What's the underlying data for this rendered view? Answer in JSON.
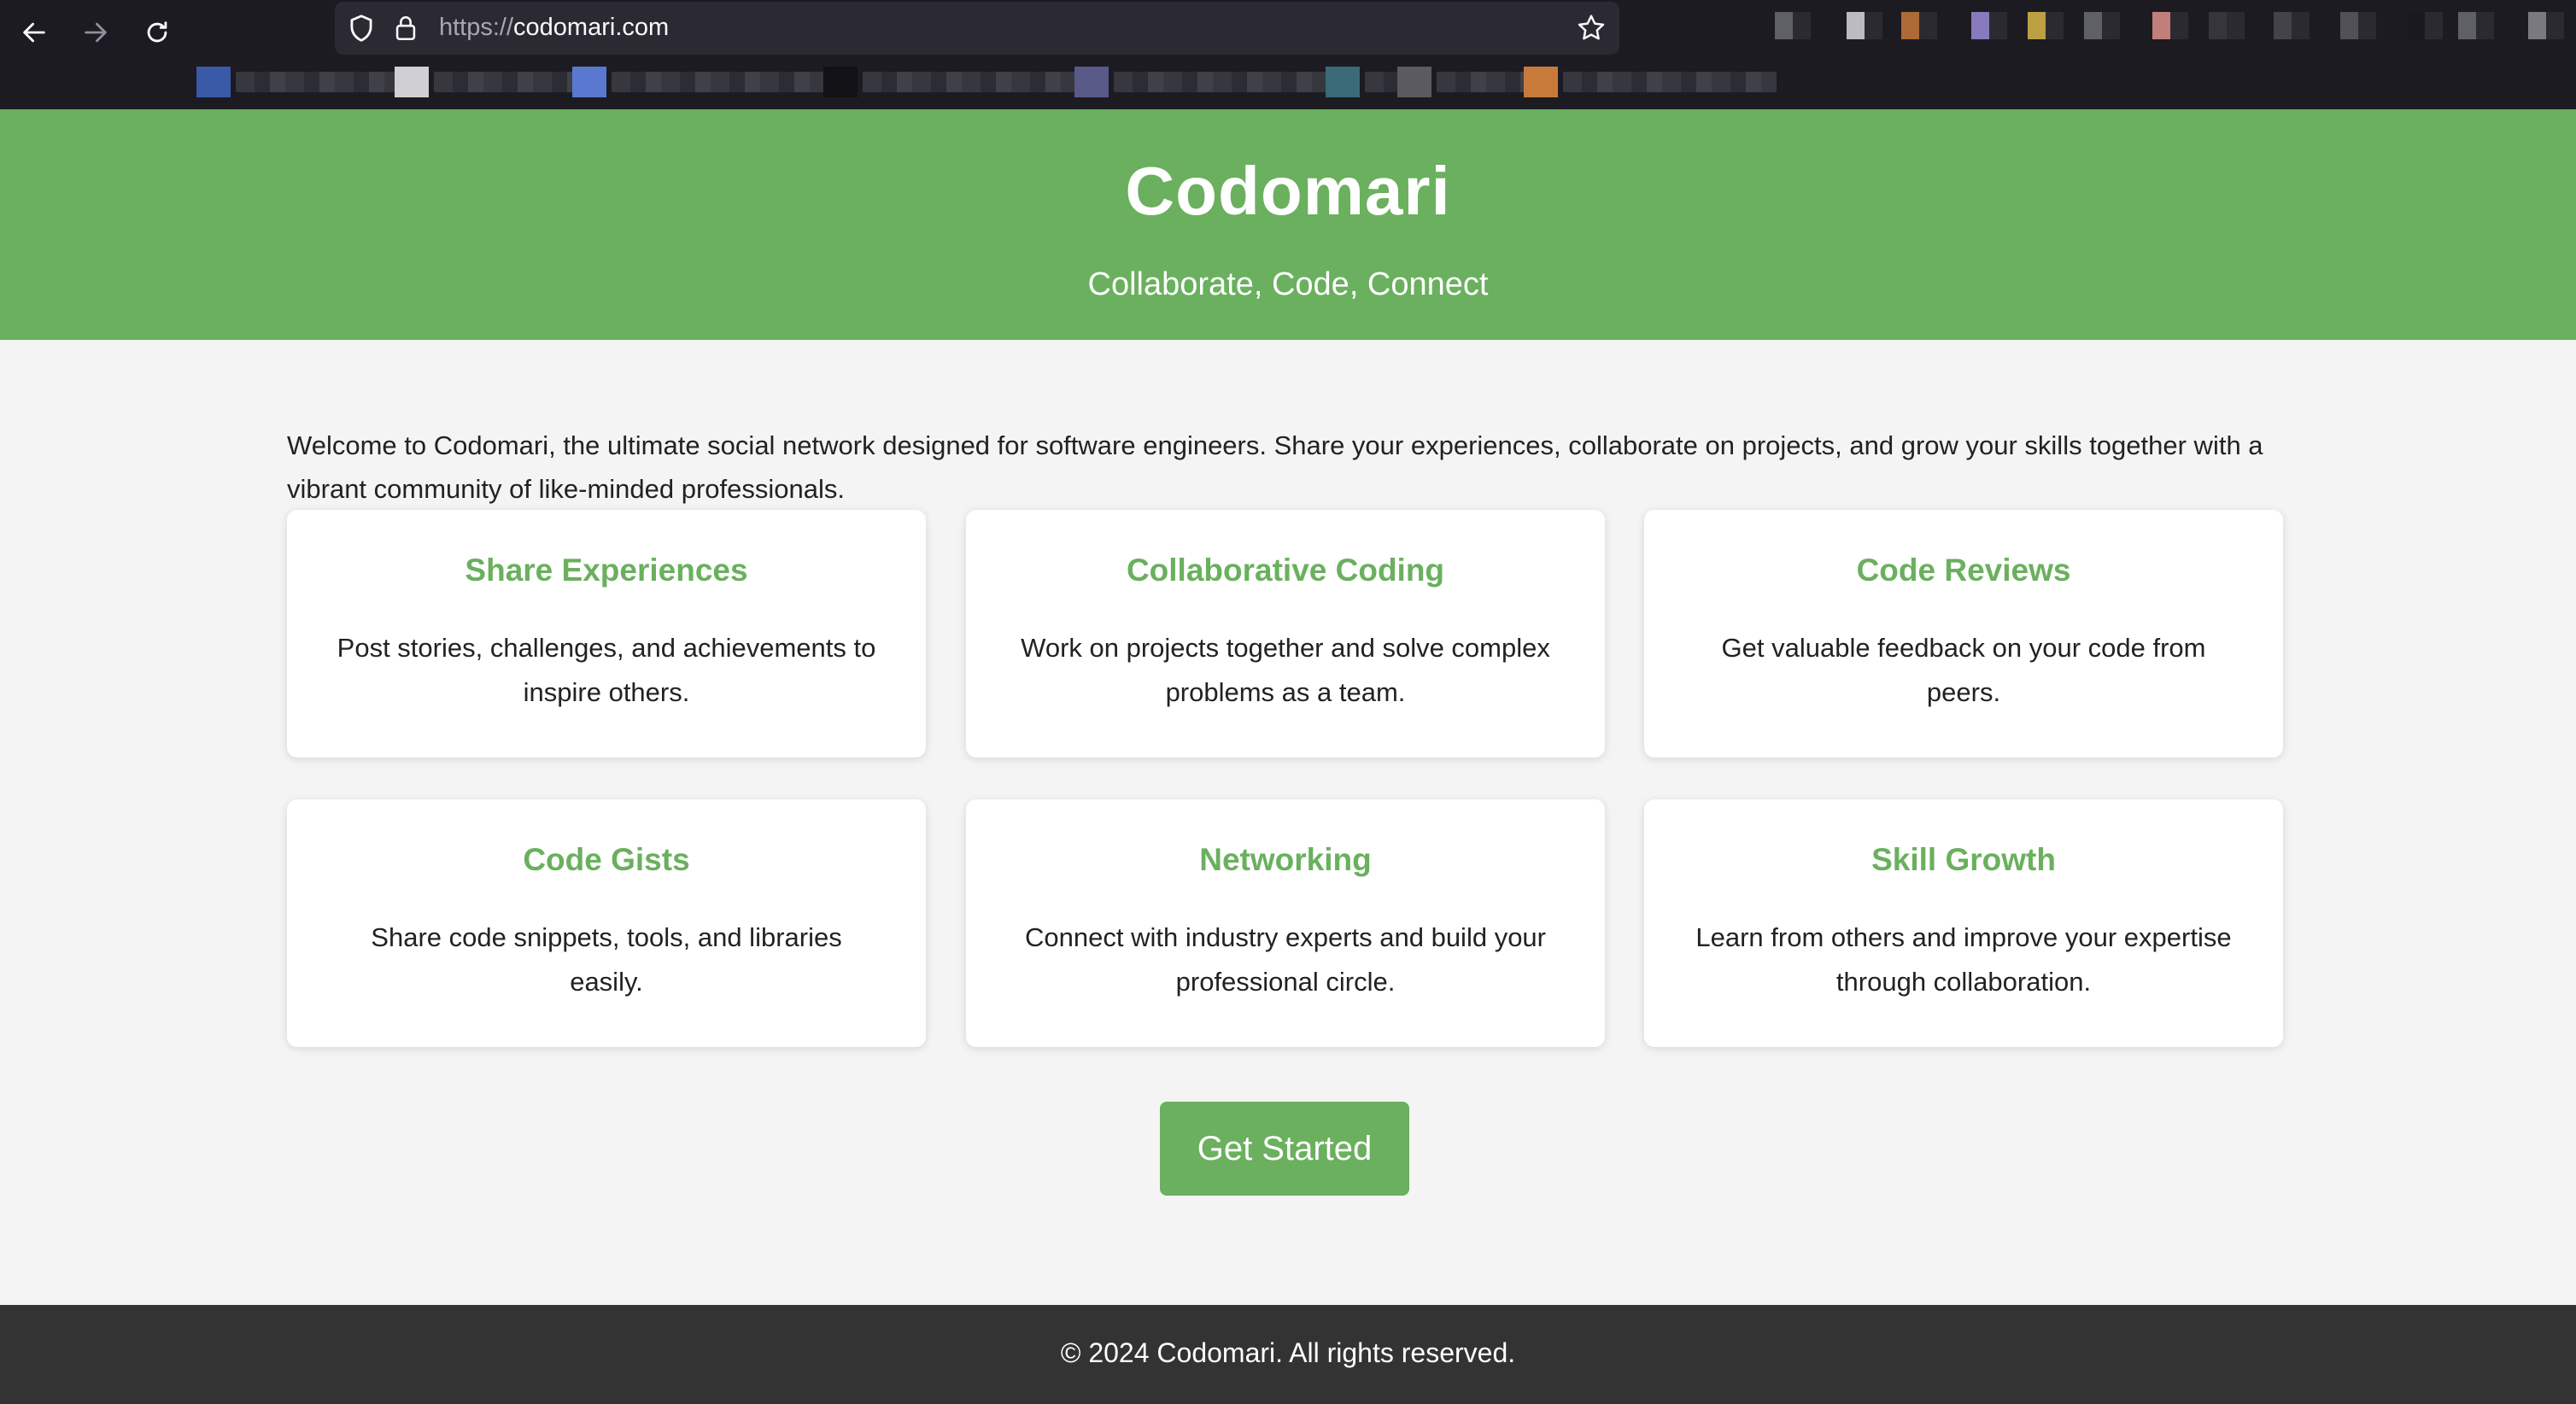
{
  "browser": {
    "url_scheme": "https://",
    "url_host": "codomari.com",
    "extension_icon_colors": [
      "#6b6b72",
      "#d8d8dc",
      "#c8783a",
      "#9a8cd8",
      "#d8b848",
      "#6b6b72",
      "#e0908a",
      "#3a3a40",
      "#4a4a50",
      "#5a5a60",
      "#1a1a1e",
      "#6b6b72",
      "#8a8a90"
    ],
    "bookmark_colors": [
      "#3a5aa8",
      "#d0d0d4",
      "#5a78d0",
      "#111116",
      "#5a5a88",
      "#3a6a78",
      "#5a5a60",
      "#c87a3a"
    ]
  },
  "hero": {
    "title": "Codomari",
    "tagline": "Collaborate, Code, Connect",
    "background": "#6ab05e"
  },
  "intro": "Welcome to Codomari, the ultimate social network designed for software engineers. Share your experiences, collaborate on projects, and grow your skills together with a vibrant community of like-minded professionals.",
  "features": [
    {
      "title": "Share Experiences",
      "text": "Post stories, challenges, and achievements to inspire others."
    },
    {
      "title": "Collaborative Coding",
      "text": "Work on projects together and solve complex problems as a team."
    },
    {
      "title": "Code Reviews",
      "text": "Get valuable feedback on your code from peers."
    },
    {
      "title": "Code Gists",
      "text": "Share code snippets, tools, and libraries easily."
    },
    {
      "title": "Networking",
      "text": "Connect with industry experts and build your professional circle."
    },
    {
      "title": "Skill Growth",
      "text": "Learn from others and improve your expertise through collaboration."
    }
  ],
  "cta": {
    "label": "Get Started"
  },
  "footer": {
    "text": "© 2024 Codomari. All rights reserved."
  }
}
